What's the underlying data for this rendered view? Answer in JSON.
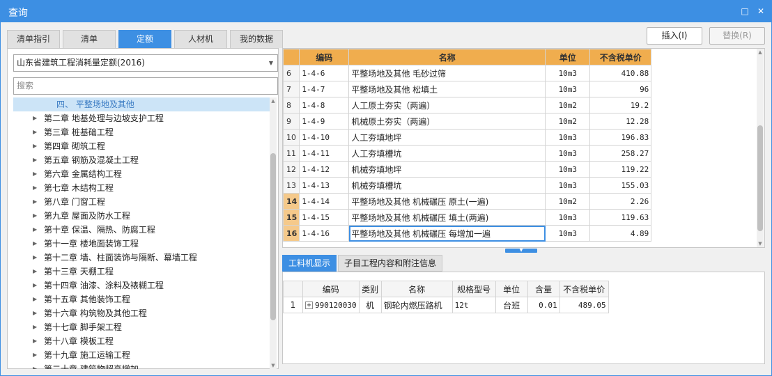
{
  "window": {
    "title": "查询",
    "restore_icon": "□",
    "close_icon": "✕"
  },
  "tabs": [
    "清单指引",
    "清单",
    "定额",
    "人材机",
    "我的数据"
  ],
  "active_tab": 2,
  "toolbar": {
    "insert_label": "插入(I)",
    "replace_label": "替换(R)"
  },
  "left": {
    "library_select": "山东省建筑工程消耗量定额(2016)",
    "search_placeholder": "搜索",
    "tree_selected": "四、 平整场地及其他",
    "tree_items": [
      "第二章 地基处理与边坡支护工程",
      "第三章 桩基础工程",
      "第四章 砌筑工程",
      "第五章 钢筋及混凝土工程",
      "第六章 金属结构工程",
      "第七章 木结构工程",
      "第八章 门窗工程",
      "第九章 屋面及防水工程",
      "第十章 保温、隔热、防腐工程",
      "第十一章 楼地面装饰工程",
      "第十二章 墙、柱面装饰与隔断、幕墙工程",
      "第十三章 天棚工程",
      "第十四章 油漆、涂料及裱糊工程",
      "第十五章 其他装饰工程",
      "第十六章 构筑物及其他工程",
      "第十七章 脚手架工程",
      "第十八章 模板工程",
      "第十九章 施工运输工程",
      "第二十章 建筑物超高增加"
    ]
  },
  "quota_table": {
    "headers": [
      "编码",
      "名称",
      "单位",
      "不含税单价"
    ],
    "rows": [
      {
        "no": "6",
        "code": "1-4-6",
        "name": "平整场地及其他 毛砂过筛",
        "unit": "10m3",
        "price": "410.88"
      },
      {
        "no": "7",
        "code": "1-4-7",
        "name": "平整场地及其他 松填土",
        "unit": "10m3",
        "price": "96"
      },
      {
        "no": "8",
        "code": "1-4-8",
        "name": "人工原土夯实（两遍）",
        "unit": "10m2",
        "price": "19.2"
      },
      {
        "no": "9",
        "code": "1-4-9",
        "name": "机械原土夯实（两遍）",
        "unit": "10m2",
        "price": "12.28"
      },
      {
        "no": "10",
        "code": "1-4-10",
        "name": "人工夯填地坪",
        "unit": "10m3",
        "price": "196.83"
      },
      {
        "no": "11",
        "code": "1-4-11",
        "name": "人工夯填槽坑",
        "unit": "10m3",
        "price": "258.27"
      },
      {
        "no": "12",
        "code": "1-4-12",
        "name": "机械夯填地坪",
        "unit": "10m3",
        "price": "119.22"
      },
      {
        "no": "13",
        "code": "1-4-13",
        "name": "机械夯填槽坑",
        "unit": "10m3",
        "price": "155.03"
      },
      {
        "no": "14",
        "code": "1-4-14",
        "name": "平整场地及其他 机械碾压 原土(一遍)",
        "unit": "10m2",
        "price": "2.26"
      },
      {
        "no": "15",
        "code": "1-4-15",
        "name": "平整场地及其他 机械碾压 填土(两遍)",
        "unit": "10m3",
        "price": "119.63"
      },
      {
        "no": "16",
        "code": "1-4-16",
        "name": "平整场地及其他 机械碾压 每增加一遍",
        "unit": "10m3",
        "price": "4.89"
      }
    ]
  },
  "bottom_tabs": [
    "工料机显示",
    "子目工程内容和附注信息"
  ],
  "resource_table": {
    "headers": [
      "编码",
      "类别",
      "名称",
      "规格型号",
      "单位",
      "含量",
      "不含税单价"
    ],
    "rows": [
      {
        "no": "1",
        "expander": "+",
        "code": "990120030",
        "type": "机",
        "name": "钢轮内燃压路机",
        "spec": "12t",
        "unit": "台班",
        "qty": "0.01",
        "price": "489.05"
      }
    ]
  },
  "colors": {
    "accent": "#3d8fe3",
    "header_orange": "#f0ad4e",
    "row_highlight": "#f5c98a"
  }
}
